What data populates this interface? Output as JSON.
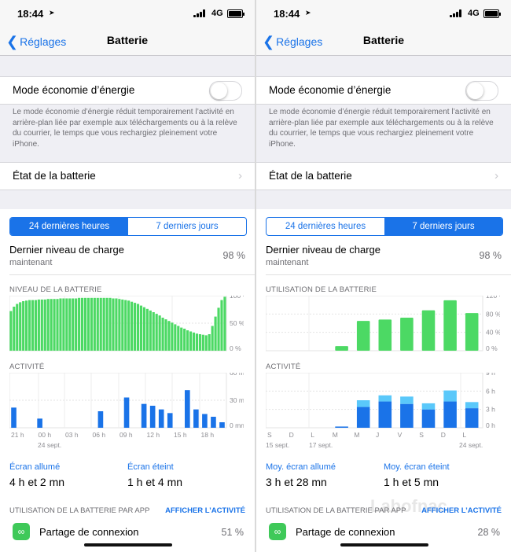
{
  "screens": [
    {
      "status": {
        "time": "18:44",
        "network": "4G"
      },
      "nav": {
        "back": "Réglages",
        "title": "Batterie"
      },
      "low_power": {
        "label": "Mode économie d’énergie",
        "enabled": false,
        "description": "Le mode économie d’énergie réduit temporairement l’activité en arrière-plan liée par exemple aux téléchargements ou à la relève du courrier, le temps que vous rechargiez pleinement votre iPhone."
      },
      "health": {
        "label": "État de la batterie"
      },
      "segments": {
        "items": [
          "24 dernières heures",
          "7 derniers jours"
        ],
        "selected": 0
      },
      "last_charge": {
        "label": "Dernier niveau de charge",
        "sub": "maintenant",
        "value": "98 %"
      },
      "level_title": "NIVEAU DE LA BATTERIE",
      "activity_title": "ACTIVITÉ",
      "chart_data": [
        {
          "type": "bar",
          "title": "NIVEAU DE LA BATTERIE",
          "y_ticks": [
            "100 %",
            "50 %",
            "0 %"
          ],
          "ylim": [
            0,
            100
          ],
          "values_pct": [
            72,
            80,
            85,
            88,
            90,
            91,
            92,
            92,
            92,
            93,
            93,
            93,
            94,
            94,
            94,
            94,
            95,
            95,
            95,
            95,
            95,
            95,
            96,
            96,
            96,
            96,
            96,
            96,
            96,
            96,
            96,
            96,
            96,
            95,
            95,
            94,
            93,
            92,
            91,
            89,
            87,
            85,
            82,
            79,
            76,
            73,
            70,
            67,
            64,
            60,
            57,
            54,
            51,
            48,
            45,
            42,
            40,
            37,
            35,
            33,
            31,
            30,
            29,
            28,
            30,
            45,
            62,
            78,
            92,
            98
          ]
        },
        {
          "type": "bar",
          "title": "ACTIVITÉ",
          "y_ticks": [
            "60 mn",
            "30 mn",
            "0 mn"
          ],
          "ylim": [
            0,
            60
          ],
          "x_ticks": [
            "21 h",
            "00 h",
            "03 h",
            "06 h",
            "09 h",
            "12 h",
            "15 h",
            "18 h"
          ],
          "date_label": "24 sept.",
          "series": [
            {
              "name": "Écran allumé",
              "values": [
                22,
                0,
                0,
                10,
                0,
                0,
                0,
                0,
                0,
                0,
                18,
                0,
                0,
                33,
                0,
                26,
                24,
                20,
                16,
                0,
                41,
                20,
                15,
                12,
                6
              ]
            },
            {
              "name": "Écran éteint",
              "values": [
                0,
                0,
                0,
                0,
                0,
                0,
                0,
                0,
                0,
                0,
                0,
                0,
                0,
                0,
                0,
                0,
                0,
                0,
                0,
                0,
                0,
                0,
                0,
                0,
                0
              ]
            }
          ]
        }
      ],
      "stats": {
        "on_label": "Écran allumé",
        "on_value": "4 h et 2 mn",
        "off_label": "Écran éteint",
        "off_value": "1 h et 4 mn"
      },
      "apps": {
        "header": "UTILISATION DE LA BATTERIE PAR APP",
        "link": "AFFICHER L’ACTIVITÉ",
        "items": [
          {
            "name": "Partage de connexion",
            "value": "51 %"
          }
        ]
      },
      "colors": {
        "accent": "#1a73e8",
        "green": "#4cd964",
        "blue": "#1a73e8",
        "light_blue": "#5ac8fa"
      }
    },
    {
      "status": {
        "time": "18:44",
        "network": "4G"
      },
      "nav": {
        "back": "Réglages",
        "title": "Batterie"
      },
      "low_power": {
        "label": "Mode économie d’énergie",
        "enabled": false,
        "description": "Le mode économie d’énergie réduit temporairement l’activité en arrière-plan liée par exemple aux téléchargements ou à la relève du courrier, le temps que vous rechargiez pleinement votre iPhone."
      },
      "health": {
        "label": "État de la batterie"
      },
      "segments": {
        "items": [
          "24 dernières heures",
          "7 derniers jours"
        ],
        "selected": 1
      },
      "last_charge": {
        "label": "Dernier niveau de charge",
        "sub": "maintenant",
        "value": "98 %"
      },
      "level_title": "UTILISATION DE LA BATTERIE",
      "activity_title": "ACTIVITÉ",
      "chart_data": [
        {
          "type": "bar",
          "title": "UTILISATION DE LA BATTERIE",
          "y_ticks": [
            "120 %",
            "80 %",
            "40 %",
            "0 %"
          ],
          "ylim": [
            0,
            120
          ],
          "categories": [
            "S",
            "D",
            "L",
            "M",
            "M",
            "J",
            "V",
            "S",
            "D",
            "L"
          ],
          "values_pct": [
            0,
            0,
            0,
            10,
            65,
            68,
            72,
            88,
            110,
            82
          ]
        },
        {
          "type": "bar",
          "title": "ACTIVITÉ",
          "y_ticks": [
            "9 h",
            "6 h",
            "3 h",
            "0 h"
          ],
          "ylim": [
            0,
            9
          ],
          "categories": [
            "S",
            "D",
            "L",
            "M",
            "M",
            "J",
            "V",
            "S",
            "D",
            "L"
          ],
          "date_labels": [
            "15 sept.",
            "17 sept.",
            "24 sept."
          ],
          "series": [
            {
              "name": "Écran allumé",
              "values": [
                0,
                0,
                0,
                0.2,
                3.4,
                4.3,
                3.9,
                3.0,
                4.3,
                3.2
              ]
            },
            {
              "name": "Écran éteint",
              "values": [
                0,
                0,
                0,
                0,
                1.1,
                1.0,
                1.2,
                1.0,
                1.8,
                1.0
              ]
            }
          ]
        }
      ],
      "stats": {
        "on_label": "Moy. écran allumé",
        "on_value": "3 h et 28 mn",
        "off_label": "Moy. écran éteint",
        "off_value": "1 h et 5 mn"
      },
      "apps": {
        "header": "UTILISATION DE LA BATTERIE PAR APP",
        "link": "AFFICHER L’ACTIVITÉ",
        "items": [
          {
            "name": "Partage de connexion",
            "value": "28 %"
          }
        ]
      },
      "colors": {
        "accent": "#1a73e8",
        "green": "#4cd964",
        "blue": "#1a73e8",
        "light_blue": "#5ac8fa"
      }
    }
  ],
  "watermark": "Labofnac"
}
